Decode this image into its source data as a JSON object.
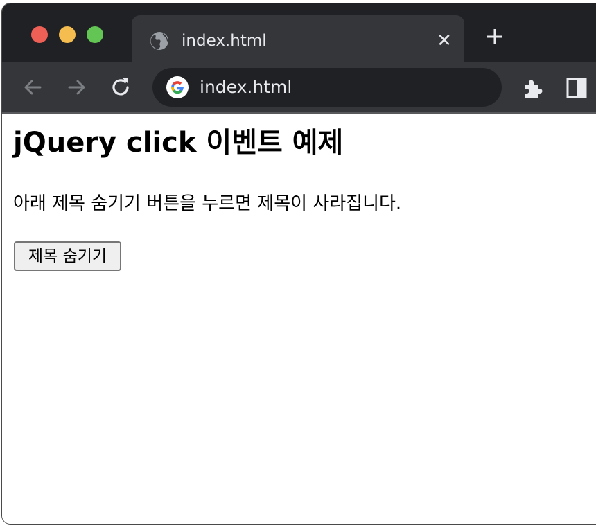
{
  "browser": {
    "tab": {
      "title": "index.html",
      "close_glyph": "✕",
      "icon": "globe-icon"
    },
    "new_tab_icon": "plus-icon",
    "toolbar": {
      "back_icon": "arrow-left-icon",
      "forward_icon": "arrow-right-icon",
      "reload_icon": "reload-icon",
      "address": "index.html",
      "site_icon": "google-logo-icon",
      "extensions_icon": "puzzle-icon",
      "side_panel_icon": "side-panel-icon"
    },
    "colors": {
      "tabbar_bg": "#202124",
      "toolbar_bg": "#35363a",
      "omnibox_bg": "#202124",
      "text": "#e8eaed",
      "close": "#ee5f56",
      "minimize": "#f5bd4f",
      "maximize": "#62c554"
    }
  },
  "page": {
    "heading": "jQuery click 이벤트 예제",
    "description": "아래 제목 숨기기 버튼을 누르면 제목이 사라집니다.",
    "hide_button_label": "제목 숨기기"
  }
}
